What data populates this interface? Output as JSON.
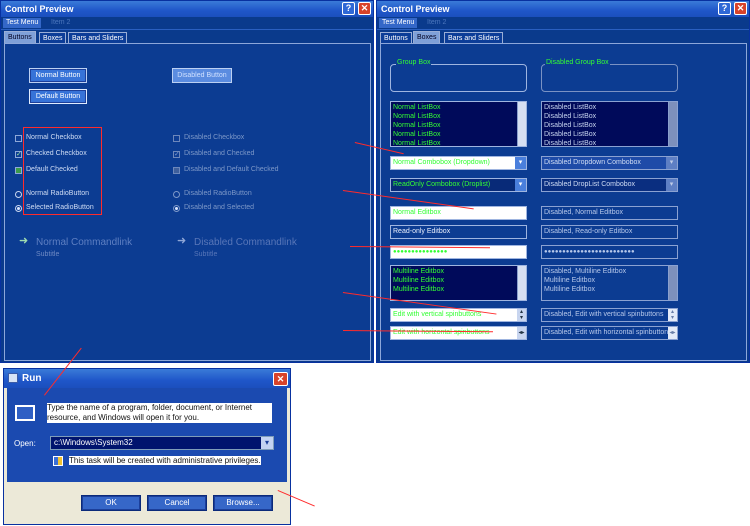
{
  "left_window": {
    "title": "Control Preview",
    "menu": {
      "active": "Test Menu",
      "disabled": "Item 2"
    },
    "tabs": [
      "Buttons",
      "Boxes",
      "Bars and Sliders"
    ],
    "buttons": {
      "normal": "Normal Button",
      "default": "Default Button",
      "disabled": "Disabled Button"
    },
    "checkboxes": [
      "Normal Checkbox",
      "Checked Checkbox",
      "Default Checked"
    ],
    "disabled_checkboxes": [
      "Disabled Checkbox",
      "Disabled and Checked",
      "Disabled and Default Checked"
    ],
    "radios": [
      "Normal RadioButton",
      "Selected RadioButton"
    ],
    "disabled_radios": [
      "Disabled RadioButton",
      "Disabled and Selected"
    ],
    "commandlinks": [
      {
        "title": "Normal Commandlink",
        "subtitle": "Subtitle"
      },
      {
        "title": "Disabled Commandlink",
        "subtitle": "Subtitle"
      }
    ]
  },
  "right_window": {
    "title": "Control Preview",
    "menu": {
      "active": "Test Menu",
      "disabled": "Item 2"
    },
    "tabs": [
      "Buttons",
      "Boxes",
      "Bars and Sliders"
    ],
    "groupboxes": [
      "Group Box",
      "Disabled Group Box"
    ],
    "listbox_items": [
      "Normal ListBox",
      "Normal ListBox",
      "Normal ListBox",
      "Normal ListBox",
      "Normal ListBox"
    ],
    "disabled_listbox_items": [
      "Disabled ListBox",
      "Disabled ListBox",
      "Disabled ListBox",
      "Disabled ListBox",
      "Disabled ListBox"
    ],
    "combo_dropdown": "Normal Combobox (Dropdown)",
    "combo_droplist": "ReadOnly Combobox (Droplist)",
    "disabled_combo_dropdown": "Disabled Dropdown Combobox",
    "disabled_combo_droplist": "Disabled DropList Combobox",
    "normal_editbox": "Normal Editbox",
    "readonly_editbox": "Read-only Editbox",
    "password_dots": "●●●●●●●●●●●●●●●",
    "disabled_normal_editbox": "Disabled, Normal Editbox",
    "disabled_readonly_editbox": "Disabled, Read-only Editbox",
    "disabled_password_dots": "●●●●●●●●●●●●●●●●●●●●●●●●●",
    "multiline_lines": [
      "Multiline Editbox",
      "Multiline Editbox",
      "Multiline Editbox"
    ],
    "disabled_multiline_lines": [
      "Disabled, Multiline Editbox",
      "Multiline Editbox",
      "Multiline Editbox"
    ],
    "vspin_edit": "Edit with vertical spinbuttons",
    "hspin_edit": "Edit with horizontal spinbuttons",
    "disabled_vspin_edit": "Disabled, Edit with vertical spinbuttons",
    "disabled_hspin_edit": "Disabled, Edit with horizontal spinbuttons"
  },
  "run_dialog": {
    "title": "Run",
    "description": "Type the name of a program, folder, document, or Internet resource, and Windows will open it for you.",
    "open_label": "Open:",
    "open_value": "c:\\Windows\\System32",
    "admin_note": "This task will be created with administrative privileges.",
    "ok": "OK",
    "cancel": "Cancel",
    "browse": "Browse..."
  },
  "colors": {
    "window_bg": "#0a3a8c",
    "green_text": "#33ff33",
    "annotation": "#ff2b2b"
  }
}
